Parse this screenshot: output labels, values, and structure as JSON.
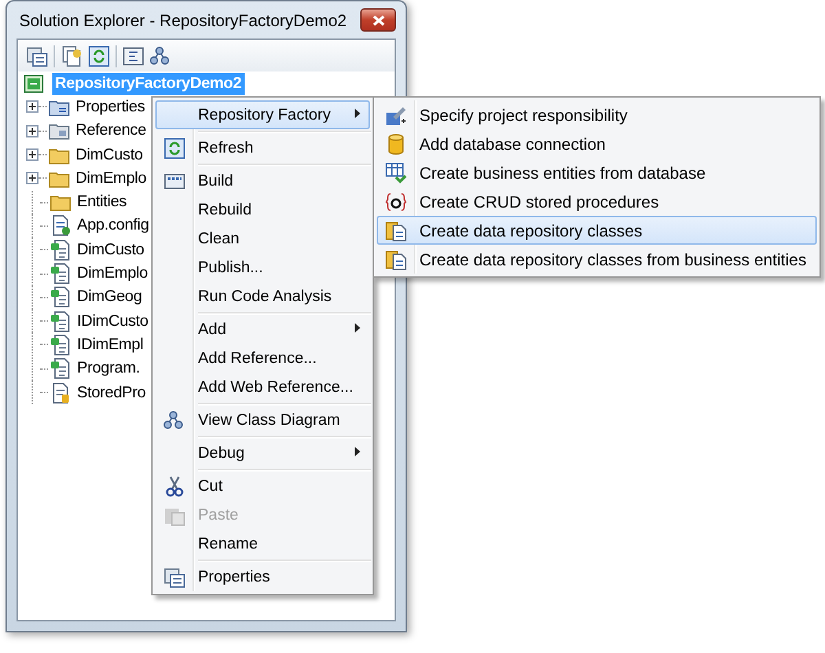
{
  "window": {
    "title": "Solution Explorer - RepositoryFactoryDemo2"
  },
  "tree": {
    "label": "RepositoryFactoryDemo2",
    "selected": true,
    "kind": "project",
    "children": [
      {
        "label": "Properties",
        "kind": "properties",
        "expandable": true,
        "selected": false
      },
      {
        "label": "Reference",
        "kind": "references",
        "expandable": true,
        "selected": false
      },
      {
        "label": "DimCusto",
        "kind": "folder",
        "expandable": true,
        "selected": false
      },
      {
        "label": "DimEmplo",
        "kind": "folder",
        "expandable": true,
        "selected": false
      },
      {
        "label": "Entities",
        "kind": "folder",
        "expandable": false,
        "selected": false
      },
      {
        "label": "App.config",
        "kind": "config",
        "expandable": false,
        "selected": false
      },
      {
        "label": "DimCusto",
        "kind": "code",
        "expandable": false,
        "selected": false
      },
      {
        "label": "DimEmplo",
        "kind": "code",
        "expandable": false,
        "selected": false
      },
      {
        "label": "DimGeog",
        "kind": "code",
        "expandable": false,
        "selected": false
      },
      {
        "label": "IDimCusto",
        "kind": "code",
        "expandable": false,
        "selected": false
      },
      {
        "label": "IDimEmpl",
        "kind": "code",
        "expandable": false,
        "selected": false
      },
      {
        "label": "Program.",
        "kind": "code",
        "expandable": false,
        "selected": false
      },
      {
        "label": "StoredPro",
        "kind": "script",
        "expandable": false,
        "selected": false
      }
    ]
  },
  "context_menu": {
    "items": [
      {
        "label": "Repository Factory",
        "kind": "plain",
        "submenu": true,
        "selected": true,
        "disabled": false,
        "separator_before": false
      },
      {
        "label": "Refresh",
        "kind": "refresh",
        "submenu": false,
        "selected": false,
        "disabled": false,
        "separator_before": true
      },
      {
        "label": "Build",
        "kind": "build",
        "submenu": false,
        "selected": false,
        "disabled": false,
        "separator_before": true
      },
      {
        "label": "Rebuild",
        "kind": "plain",
        "submenu": false,
        "selected": false,
        "disabled": false,
        "separator_before": false
      },
      {
        "label": "Clean",
        "kind": "plain",
        "submenu": false,
        "selected": false,
        "disabled": false,
        "separator_before": false
      },
      {
        "label": "Publish...",
        "kind": "plain",
        "submenu": false,
        "selected": false,
        "disabled": false,
        "separator_before": false
      },
      {
        "label": "Run Code Analysis",
        "kind": "plain",
        "submenu": false,
        "selected": false,
        "disabled": false,
        "separator_before": false
      },
      {
        "label": "Add",
        "kind": "plain",
        "submenu": true,
        "selected": false,
        "disabled": false,
        "separator_before": true
      },
      {
        "label": "Add Reference...",
        "kind": "plain",
        "submenu": false,
        "selected": false,
        "disabled": false,
        "separator_before": false
      },
      {
        "label": "Add Web Reference...",
        "kind": "plain",
        "submenu": false,
        "selected": false,
        "disabled": false,
        "separator_before": false
      },
      {
        "label": "View Class Diagram",
        "kind": "diagram",
        "submenu": false,
        "selected": false,
        "disabled": false,
        "separator_before": true
      },
      {
        "label": "Debug",
        "kind": "plain",
        "submenu": true,
        "selected": false,
        "disabled": false,
        "separator_before": true
      },
      {
        "label": "Cut",
        "kind": "cut",
        "submenu": false,
        "selected": false,
        "disabled": false,
        "separator_before": true
      },
      {
        "label": "Paste",
        "kind": "paste",
        "submenu": false,
        "selected": false,
        "disabled": true,
        "separator_before": false
      },
      {
        "label": "Rename",
        "kind": "plain",
        "submenu": false,
        "selected": false,
        "disabled": false,
        "separator_before": false
      },
      {
        "label": "Properties",
        "kind": "properties",
        "submenu": false,
        "selected": false,
        "disabled": false,
        "separator_before": true
      }
    ]
  },
  "submenu": {
    "items": [
      {
        "label": "Specify project responsibility",
        "kind": "responsibility",
        "selected": false
      },
      {
        "label": "Add database connection",
        "kind": "database",
        "selected": false
      },
      {
        "label": "Create business entities from database",
        "kind": "entities",
        "selected": false
      },
      {
        "label": "Create CRUD stored procedures",
        "kind": "procedures",
        "selected": false
      },
      {
        "label": "Create data repository classes",
        "kind": "classes",
        "selected": true
      },
      {
        "label": "Create data repository classes from business entities",
        "kind": "classes",
        "selected": false
      }
    ]
  }
}
